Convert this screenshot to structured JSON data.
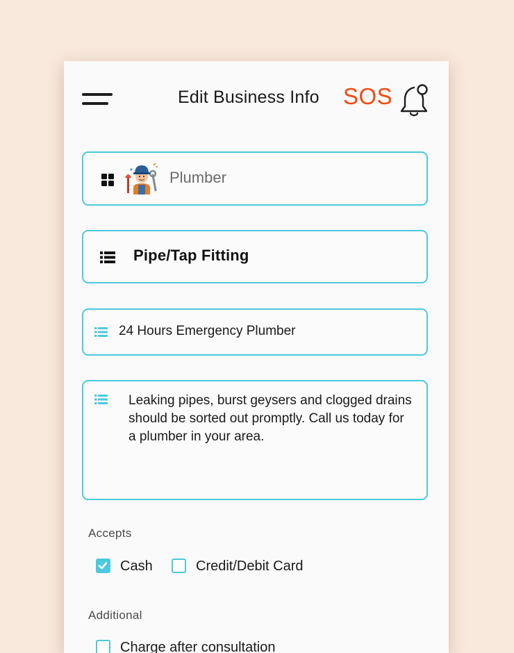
{
  "header": {
    "title": "Edit Business Info",
    "sos_label": "SOS",
    "menu_icon": "hamburger-menu-icon",
    "notification_icon": "bell-icon"
  },
  "form": {
    "category": {
      "value": "Plumber",
      "icon": "grid-icon",
      "avatar": "plumber-icon"
    },
    "service": {
      "value": "Pipe/Tap Fitting",
      "icon": "list-icon"
    },
    "business_title": {
      "value": "24 Hours Emergency Plumber",
      "icon": "list-icon"
    },
    "description": {
      "value": "Leaking pipes, burst geysers and clogged drains should be sorted out promptly. Call us today for a plumber in your area.",
      "icon": "list-icon"
    }
  },
  "accepts": {
    "label": "Accepts",
    "options": [
      {
        "label": "Cash",
        "checked": true
      },
      {
        "label": "Credit/Debit Card",
        "checked": false
      }
    ]
  },
  "additional": {
    "label": "Additional",
    "options": [
      {
        "label": "Charge after consultation",
        "checked": false
      }
    ]
  },
  "colors": {
    "accent": "#4cc9dc",
    "sos": "#f04a12",
    "background": "#f9e8dc",
    "screen": "#fafafa"
  }
}
